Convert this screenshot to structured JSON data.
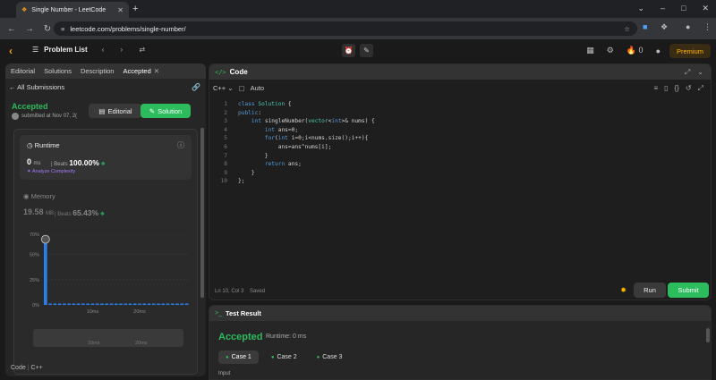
{
  "browser": {
    "tab_title": "Single Number - LeetCode",
    "url": "leetcode.com/problems/single-number/"
  },
  "nav": {
    "problem_list": "Problem List",
    "streak_count": "0",
    "premium": "Premium"
  },
  "left": {
    "tabs": [
      "Editorial",
      "Solutions",
      "Description",
      "Accepted"
    ],
    "back": "All Submissions",
    "status": "Accepted",
    "submitted": "submitted at Nov 07, 2(",
    "editorial_btn": "Editorial",
    "solution_btn": "Solution",
    "runtime": {
      "label": "Runtime",
      "value": "0",
      "unit": "ms",
      "beats_label": "Beats",
      "beats_value": "100.00%",
      "analyze": "Analyze Complexity"
    },
    "memory": {
      "label": "Memory",
      "value": "19.58",
      "unit": "MB",
      "beats_label": "Beats",
      "beats_value": "65.43%"
    },
    "footer_code": "Code",
    "footer_lang": "C++"
  },
  "chart_data": {
    "type": "bar",
    "title": "",
    "xlabel": "",
    "ylabel": "",
    "ytick_labels": [
      "70%",
      "50%",
      "25%",
      "0%"
    ],
    "yticks": [
      70,
      50,
      25,
      0
    ],
    "ylim": [
      0,
      70
    ],
    "xtick_labels": [
      "10ms",
      "20ms"
    ],
    "xticks": [
      10,
      20
    ],
    "xlim": [
      0,
      31
    ],
    "x": [
      0,
      1,
      2,
      3,
      4,
      5,
      6,
      7,
      8,
      9,
      10,
      11,
      12,
      13,
      14,
      15,
      16,
      17,
      18,
      19,
      20,
      21,
      22,
      23,
      24,
      25,
      26,
      27,
      28,
      29,
      30
    ],
    "values": [
      65,
      1,
      0.5,
      0.5,
      0.5,
      0.5,
      0.5,
      0.5,
      0.5,
      0.5,
      0.5,
      0.5,
      0.5,
      0.5,
      0.5,
      0.5,
      0.5,
      0.5,
      0.5,
      0.5,
      0.5,
      0.5,
      0.5,
      0.5,
      0.5,
      0.5,
      0.5,
      0.5,
      0.5,
      0.5,
      0.5
    ],
    "highlight_index": 0,
    "color": "#2b7de9",
    "grid": true,
    "scroll_labels": [
      "10ms",
      "20ms"
    ]
  },
  "code": {
    "title": "Code",
    "language": "C++",
    "mode": "Auto",
    "lines": [
      {
        "n": "1",
        "parts": [
          [
            "kw",
            "class "
          ],
          [
            "ty",
            "Solution"
          ],
          [
            "tx",
            " {"
          ]
        ]
      },
      {
        "n": "2",
        "parts": [
          [
            "kw",
            "public"
          ],
          [
            "tx",
            ":"
          ]
        ]
      },
      {
        "n": "3",
        "parts": [
          [
            "tx",
            "    "
          ],
          [
            "kw",
            "int "
          ],
          [
            "tx",
            "singleNumber("
          ],
          [
            "ty",
            "vector"
          ],
          [
            "tx",
            "<"
          ],
          [
            "kw",
            "int"
          ],
          [
            "tx",
            ">& nums) {"
          ]
        ]
      },
      {
        "n": "4",
        "parts": [
          [
            "tx",
            "        "
          ],
          [
            "kw",
            "int "
          ],
          [
            "tx",
            "ans=0;"
          ]
        ]
      },
      {
        "n": "5",
        "parts": [
          [
            "tx",
            "        "
          ],
          [
            "kw",
            "for"
          ],
          [
            "tx",
            "("
          ],
          [
            "kw",
            "int "
          ],
          [
            "tx",
            "i=0;i<nums.size();i++){"
          ]
        ]
      },
      {
        "n": "6",
        "parts": [
          [
            "tx",
            "            ans=ans^nums[i];"
          ]
        ]
      },
      {
        "n": "7",
        "parts": [
          [
            "tx",
            "        }"
          ]
        ]
      },
      {
        "n": "8",
        "parts": [
          [
            "tx",
            "        "
          ],
          [
            "kw",
            "return "
          ],
          [
            "tx",
            "ans;"
          ]
        ]
      },
      {
        "n": "9",
        "parts": [
          [
            "tx",
            "    }"
          ]
        ]
      },
      {
        "n": "10",
        "parts": [
          [
            "tx",
            "};"
          ]
        ]
      }
    ],
    "status": "Ln 10, Col 3",
    "saved": "Saved",
    "run": "Run",
    "submit": "Submit"
  },
  "test": {
    "title": "Test Result",
    "status": "Accepted",
    "runtime": "Runtime: 0 ms",
    "cases": [
      "Case 1",
      "Case 2",
      "Case 3"
    ],
    "input_label": "Input"
  }
}
